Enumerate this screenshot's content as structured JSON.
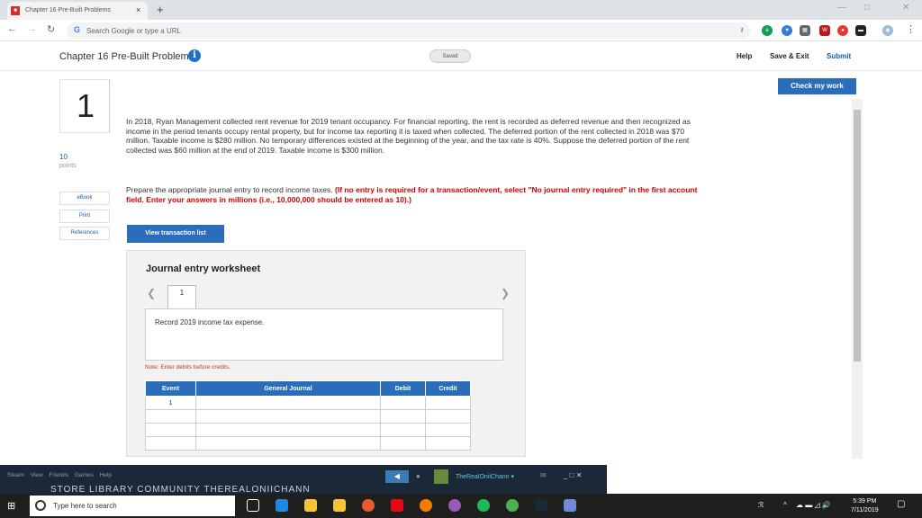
{
  "browser": {
    "tab_title": "Chapter 16 Pre-Built Problems",
    "tab_close": "×",
    "new_tab": "+",
    "omnibox_placeholder": "Search Google or type a URL"
  },
  "page": {
    "title": "Chapter 16 Pre-Built Problems",
    "saved_label": "Saved",
    "help": "Help",
    "save_exit": "Save & Exit",
    "submit": "Submit",
    "check_work": "Check my work"
  },
  "question": {
    "number": "1",
    "points": "10",
    "points_label": "points",
    "ebook": "eBook",
    "print": "Print",
    "references": "References",
    "text": "In 2018, Ryan Management collected rent revenue for 2019 tenant occupancy. For financial reporting, the rent is recorded as deferred revenue and then recognized as income in the period tenants occupy rental property, but for income tax reporting it is taxed when collected. The deferred portion of the rent collected in 2018 was $70 million. Taxable income is $280 million. No temporary differences existed at the beginning of the year, and the tax rate is 40%. Suppose the deferred portion of the rent collected was $60 million at the end of 2019. Taxable income is $300 million.",
    "instruction_plain": "Prepare the appropriate journal entry to record income taxes. ",
    "instruction_red": "(If no entry is required for a transaction/event, select \"No journal entry required\" in the first account field. Enter your answers in millions (i.e., 10,000,000 should be entered as 10).)",
    "view_transaction": "View transaction list"
  },
  "worksheet": {
    "title": "Journal entry worksheet",
    "page": "1",
    "record_text": "Record 2019 income tax expense.",
    "note": "Note: Enter debits before credits.",
    "columns": [
      "Event",
      "General Journal",
      "Debit",
      "Credit"
    ],
    "first_event": "1"
  },
  "steam": {
    "menu": "Steam View Friends Games Help",
    "nav": "STORE LIBRARY COMMUNITY THEREALONIICHANN",
    "user": "TheRealOniiChann ▾"
  },
  "taskbar": {
    "search_placeholder": "Type here to search",
    "time": "5:39 PM",
    "date": "7/11/2019"
  },
  "colors": {
    "accent_blue": "#2a6ebb",
    "instruction_red": "#d00000",
    "steam_bg": "#1b2838"
  }
}
